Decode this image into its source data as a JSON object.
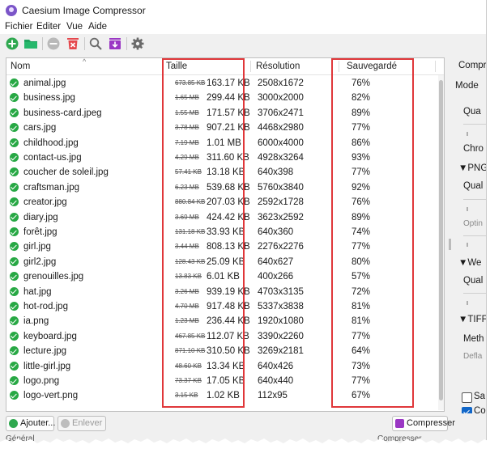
{
  "app": {
    "title": "Caesium Image Compressor"
  },
  "menu": {
    "items": [
      "Fichier",
      "Editer",
      "Vue",
      "Aide"
    ]
  },
  "toolbar": {
    "icons": [
      "add-files-icon",
      "add-folder-icon",
      "remove-icon",
      "clear-list-icon",
      "search-icon",
      "export-icon",
      "settings-icon"
    ]
  },
  "table": {
    "headers": {
      "name": "Nom",
      "size": "Taille",
      "resolution": "Résolution",
      "saved": "Sauvegardé"
    },
    "rows": [
      {
        "name": "animal.jpg",
        "old": "673.85 KB",
        "new": "163.17 KB",
        "res": "2508x1672",
        "saved": "76%"
      },
      {
        "name": "business.jpg",
        "old": "1.65 MB",
        "new": "299.44 KB",
        "res": "3000x2000",
        "saved": "82%"
      },
      {
        "name": "business-card.jpeg",
        "old": "1.55 MB",
        "new": "171.57 KB",
        "res": "3706x2471",
        "saved": "89%"
      },
      {
        "name": "cars.jpg",
        "old": "3.78 MB",
        "new": "907.21 KB",
        "res": "4468x2980",
        "saved": "77%"
      },
      {
        "name": "childhood.jpg",
        "old": "7.19 MB",
        "new": "1.01 MB",
        "res": "6000x4000",
        "saved": "86%"
      },
      {
        "name": "contact-us.jpg",
        "old": "4.29 MB",
        "new": "311.60 KB",
        "res": "4928x3264",
        "saved": "93%"
      },
      {
        "name": "coucher de soleil.jpg",
        "old": "57.41 KB",
        "new": "13.18 KB",
        "res": "640x398",
        "saved": "77%"
      },
      {
        "name": "craftsman.jpg",
        "old": "6.23 MB",
        "new": "539.68 KB",
        "res": "5760x3840",
        "saved": "92%"
      },
      {
        "name": "creator.jpg",
        "old": "880.84 KB",
        "new": "207.03 KB",
        "res": "2592x1728",
        "saved": "76%"
      },
      {
        "name": "diary.jpg",
        "old": "3.69 MB",
        "new": "424.42 KB",
        "res": "3623x2592",
        "saved": "89%"
      },
      {
        "name": "forêt.jpg",
        "old": "131.18 KB",
        "new": "33.93 KB",
        "res": "640x360",
        "saved": "74%"
      },
      {
        "name": "girl.jpg",
        "old": "3.44 MB",
        "new": "808.13 KB",
        "res": "2276x2276",
        "saved": "77%"
      },
      {
        "name": "girl2.jpg",
        "old": "128.43 KB",
        "new": "25.09 KB",
        "res": "640x627",
        "saved": "80%"
      },
      {
        "name": "grenouilles.jpg",
        "old": "13.83 KB",
        "new": "6.01 KB",
        "res": "400x266",
        "saved": "57%"
      },
      {
        "name": "hat.jpg",
        "old": "3.26 MB",
        "new": "939.19 KB",
        "res": "4703x3135",
        "saved": "72%"
      },
      {
        "name": "hot-rod.jpg",
        "old": "4.70 MB",
        "new": "917.48 KB",
        "res": "5337x3838",
        "saved": "81%"
      },
      {
        "name": "ia.png",
        "old": "1.23 MB",
        "new": "236.44 KB",
        "res": "1920x1080",
        "saved": "81%"
      },
      {
        "name": "keyboard.jpg",
        "old": "467.85 KB",
        "new": "112.07 KB",
        "res": "3390x2260",
        "saved": "77%"
      },
      {
        "name": "lecture.jpg",
        "old": "871.10 KB",
        "new": "310.50 KB",
        "res": "3269x2181",
        "saved": "64%"
      },
      {
        "name": "little-girl.jpg",
        "old": "48.60 KB",
        "new": "13.34 KB",
        "res": "640x426",
        "saved": "73%"
      },
      {
        "name": "logo.png",
        "old": "73.37 KB",
        "new": "17.05 KB",
        "res": "640x440",
        "saved": "77%"
      },
      {
        "name": "logo-vert.png",
        "old": "3.15 KB",
        "new": "1.02 KB",
        "res": "112x95",
        "saved": "67%"
      }
    ]
  },
  "right_panel": {
    "labels": [
      "Compre",
      "Mode",
      "Qua",
      "Chro",
      "▼PNG",
      "Qual",
      "Optin",
      "▼We",
      "Qual",
      "▼TIFF",
      "Meth",
      "Defla"
    ],
    "checkboxes": [
      {
        "label": "Sa",
        "checked": false
      },
      {
        "label": "Co",
        "checked": true
      }
    ]
  },
  "buttons": {
    "add": "Ajouter...",
    "remove": "Enlever",
    "compress": "Compresser"
  },
  "status": {
    "left": "Général",
    "right": "Compresser"
  },
  "colors": {
    "check_green": "#27a844",
    "highlight_red": "#e0373a",
    "accent_purple": "#9a37c4",
    "clear_red": "#e5484d"
  }
}
